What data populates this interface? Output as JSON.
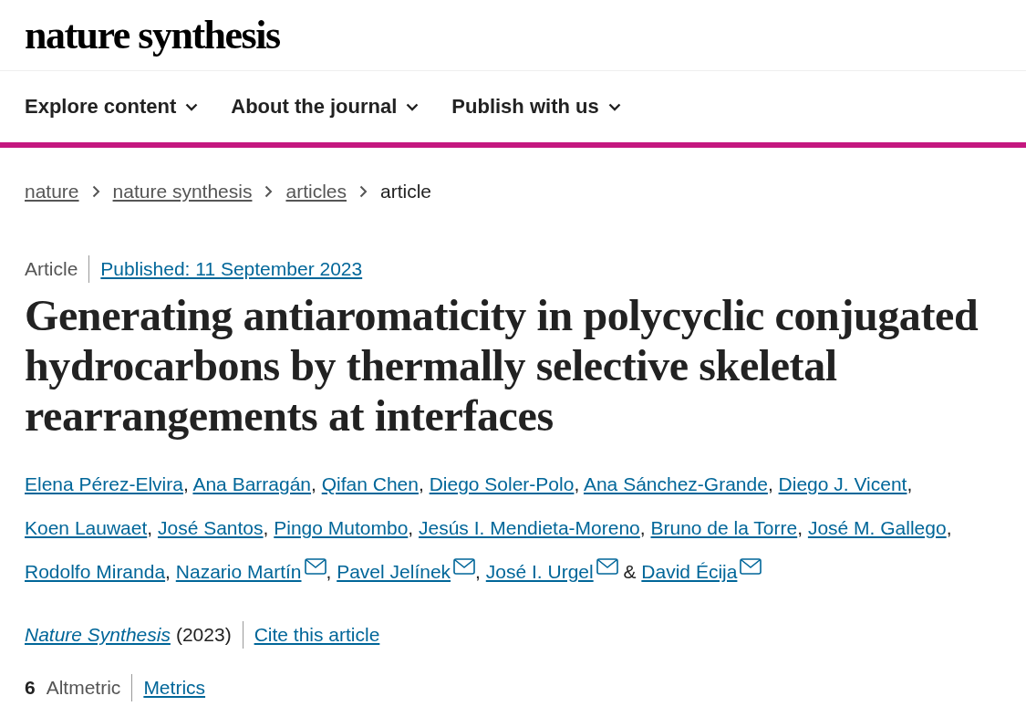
{
  "logo": "nature synthesis",
  "nav": [
    {
      "label": "Explore content",
      "expanded": false
    },
    {
      "label": "About the journal",
      "expanded": false
    },
    {
      "label": "Publish with us",
      "expanded": false
    }
  ],
  "breadcrumbs": [
    {
      "label": "nature",
      "kind": "link"
    },
    {
      "label": "nature synthesis",
      "kind": "link"
    },
    {
      "label": "articles",
      "kind": "link"
    },
    {
      "label": "article",
      "kind": "current"
    }
  ],
  "article_type": "Article",
  "published": "Published: 11 September 2023",
  "title": "Generating antiaromaticity in polycyclic conjugated hydrocarbons by thermally selective skeletal rearrangements at interfaces",
  "authors": [
    {
      "name": "Elena Pérez-Elvira",
      "email": false,
      "after": ","
    },
    {
      "name": "Ana Barragán",
      "email": false,
      "after": ","
    },
    {
      "name": "Qifan Chen",
      "email": false,
      "after": ","
    },
    {
      "name": "Diego Soler-Polo",
      "email": false,
      "after": ","
    },
    {
      "name": "Ana Sánchez-Grande",
      "email": false,
      "after": ","
    },
    {
      "name": "Diego J. Vicent",
      "email": false,
      "after": ","
    },
    {
      "name": "Koen Lauwaet",
      "email": false,
      "after": ","
    },
    {
      "name": "José Santos",
      "email": false,
      "after": ","
    },
    {
      "name": "Pingo Mutombo",
      "email": false,
      "after": ","
    },
    {
      "name": "Jesús I. Mendieta-Moreno",
      "email": false,
      "after": ","
    },
    {
      "name": "Bruno de la Torre",
      "email": false,
      "after": ","
    },
    {
      "name": "José M. Gallego",
      "email": false,
      "after": ","
    },
    {
      "name": "Rodolfo Miranda",
      "email": false,
      "after": ","
    },
    {
      "name": "Nazario Martín",
      "email": true,
      "after": ","
    },
    {
      "name": "Pavel Jelínek",
      "email": true,
      "after": ","
    },
    {
      "name": "José I. Urgel",
      "email": true,
      "after": "&"
    },
    {
      "name": "David Écija",
      "email": true
    }
  ],
  "citation": {
    "journal": "Nature Synthesis",
    "year": "(2023)",
    "cite_link": "Cite this article"
  },
  "metrics": {
    "count": "6",
    "label": "Altmetric",
    "link": "Metrics"
  }
}
